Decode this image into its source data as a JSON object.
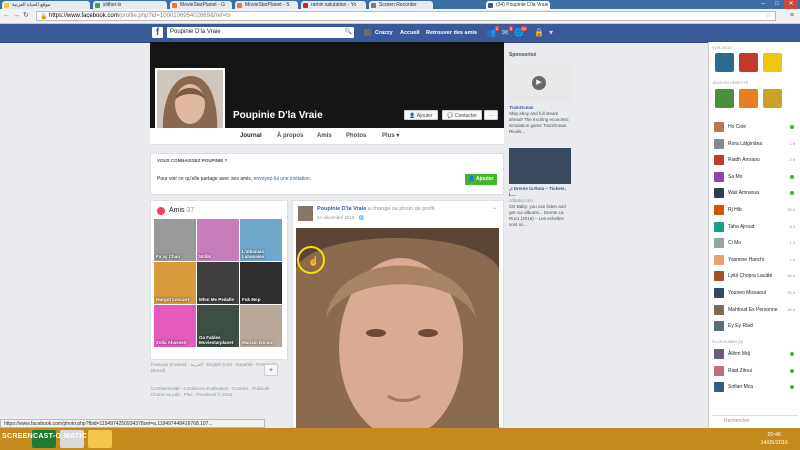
{
  "browser": {
    "tabs": [
      {
        "label": "موقع الحياة العربية",
        "icon_color": "#f8d21a"
      },
      {
        "label": "slither.io",
        "icon_color": "#3ba54a"
      },
      {
        "label": "MovieStarPlanet - G",
        "icon_color": "#f27b20"
      },
      {
        "label": "MovieStarPlanet - S",
        "icon_color": "#f27b20"
      },
      {
        "label": "ramin salutation - Yo",
        "icon_color": "#e62117"
      },
      {
        "label": "Screen Recorder",
        "icon_color": "#7a7a7a"
      },
      {
        "label": "(34) Poupinie D'la Vraie",
        "icon_color": "#3b5998"
      }
    ],
    "url_host": "https://www.facebook.com",
    "url_path": "/profile.php?id=100010695402669&fref=ts",
    "status_url": "https://www.facebook.com/photo.php?fbid=1194974250934378set=a.119497448416768.107..."
  },
  "header": {
    "search_value": "Poupinie D'la Vraie",
    "user_name": "Crazzy",
    "home_label": "Accueil",
    "find_friends_label": "Retrouver des amis",
    "friend_badge": "2",
    "message_badge": "5",
    "notif_badge": "34"
  },
  "profile": {
    "name": "Poupinie D'la Vraie",
    "add_button": "Ajouter",
    "message_button": "Contacter",
    "more_button": "···",
    "tabs": [
      "Journal",
      "À propos",
      "Amis",
      "Photos",
      "Plus ▾"
    ]
  },
  "know": {
    "title": "VOUS CONNAISSEZ POUPINIE ?",
    "text": "Pour voir ce qu'elle partage avec ses amis,",
    "link": "envoyez-lui une invitation.",
    "button": "Ajouter"
  },
  "friends": {
    "title": "Amis",
    "count": "37",
    "tiles": [
      {
        "caption": "Fa ay Chan",
        "color": "#9a9a9a"
      },
      {
        "caption": "Wifilk",
        "color": "#c77dbb"
      },
      {
        "caption": "L'albanais Labanaise",
        "color": "#6fa8c8"
      },
      {
        "caption": "Margot Lenazet",
        "color": "#d89a3a"
      },
      {
        "caption": "Mhm Me Pedalle",
        "color": "#3f3f3f"
      },
      {
        "caption": "Fuk Mop",
        "color": "#2f2f2f"
      },
      {
        "caption": "Zolla Ahassen",
        "color": "#e45bbd"
      },
      {
        "caption": "Oa Fables Moviestarplanet",
        "color": "#3d4f45"
      },
      {
        "caption": "Mariam Ikiniuri",
        "color": "#b8a89a"
      }
    ]
  },
  "languages": "Français (France) · العربية · English (US) · Español · Português (Brasil)",
  "footer": "Confidentialité · Conditions d'utilisation · Cookies · Publicité · Choisir sa pub · Plus · Facebook © 2016",
  "post": {
    "author": "Poupinie D'la Vraie",
    "action": "a changé sa photo de profil.",
    "date": "24 décembre 2015 · 🌐"
  },
  "ads": {
    "sponsored": "Sponsorisé",
    "ad1_title": "TrainOcean",
    "ad1_body": "Ship ahoy and full steam ahead! The exciting economic simulation game TrainOcean. Rivals...",
    "ad2_title": "„I Drente la Ruta – Tickets, L…",
    "ad2_site": "cdbaby.com",
    "ad2_body": "CD Baby: you can listen and get our albums... Drente La Ruc1 (2016) – Les echelles sont ici..."
  },
  "chat": {
    "games_label": "VOS JEUX",
    "suggest_label": "JEUX EN VEDETTE",
    "more_label": "Plus d'amis (3)",
    "search_placeholder": "Rechercher",
    "game_colors": [
      "#2d6a8f",
      "#c0392b",
      "#f1c40f",
      "#4a8f3a",
      "#e67e22",
      "#c9a227"
    ],
    "contacts": [
      {
        "name": "Ho Cine",
        "status": "",
        "online": true,
        "color": "#b07b55"
      },
      {
        "name": "Rora Lâtginâna",
        "status": "1 h",
        "online": false,
        "color": "#7f8c8d"
      },
      {
        "name": "Riadh Amraou",
        "status": "2 h",
        "online": false,
        "color": "#c0392b"
      },
      {
        "name": "Sa Mo",
        "status": "",
        "online": true,
        "color": "#8e44ad"
      },
      {
        "name": "Wali Amraoua",
        "status": "",
        "online": true,
        "color": "#2c3e50"
      },
      {
        "name": "Rj Hib",
        "status": "28 h",
        "online": false,
        "color": "#d35400"
      },
      {
        "name": "Taha Ajroud",
        "status": "6 h",
        "online": false,
        "color": "#16a085"
      },
      {
        "name": "Ci Mo",
        "status": "1 h",
        "online": false,
        "color": "#95a5a6"
      },
      {
        "name": "Yasmine Hanchi",
        "status": "1 h",
        "online": false,
        "color": "#e6a07c"
      },
      {
        "name": "Lyliä Çhopra Lacâté",
        "status": "16 h",
        "online": false,
        "color": "#a0522d"
      },
      {
        "name": "Youneo Missaoui",
        "status": "29 h",
        "online": false,
        "color": "#34495e"
      },
      {
        "name": "Mahfoud Ex Personne",
        "status": "16 h",
        "online": false,
        "color": "#7f6a55"
      },
      {
        "name": "Ey Ey Riad",
        "status": "",
        "online": false,
        "color": "#5a6e7a"
      }
    ],
    "more_contacts": [
      {
        "name": "Âlihm Mdj",
        "status": "",
        "online": true,
        "color": "#6c5b7b"
      },
      {
        "name": "Riad Zitoui",
        "status": "",
        "online": true,
        "color": "#c06c84"
      },
      {
        "name": "Sofian Mca",
        "status": "",
        "online": true,
        "color": "#355c7d"
      }
    ]
  },
  "taskbar": {
    "watermark": "SCREENCAST-O-MATIC",
    "time": "20:46",
    "date": "14/05/2016"
  }
}
